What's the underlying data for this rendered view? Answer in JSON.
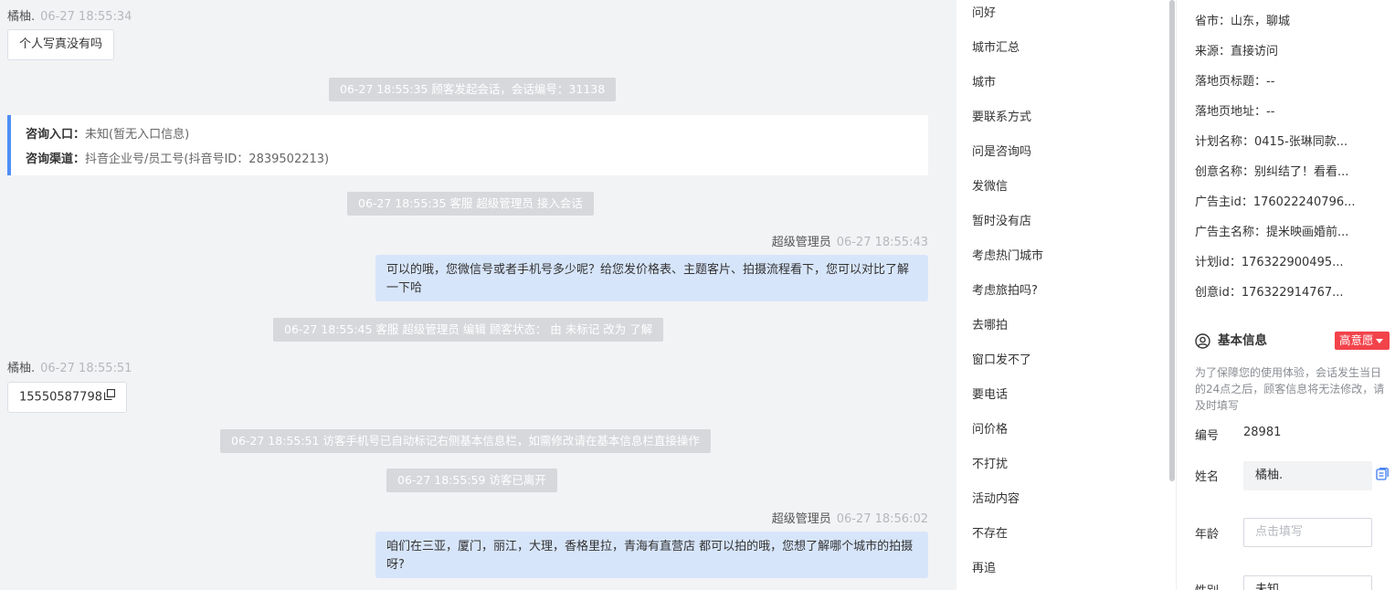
{
  "chat": {
    "msg1": {
      "name": "橘柚.",
      "time": "06-27 18:55:34",
      "text": "个人写真没有吗"
    },
    "sys1": "06-27 18:55:35 顾客发起会话，会话编号：31138",
    "card": {
      "entry_label": "咨询入口：",
      "entry_value": "未知(暂无入口信息)",
      "channel_label": "咨询渠道：",
      "channel_value": "抖音企业号/员工号(抖音号ID：2839502213)"
    },
    "sys2": "06-27 18:55:35 客服 超级管理员 接入会话",
    "msg2": {
      "name": "超级管理员",
      "time": "06-27 18:55:43",
      "text": "可以的哦，您微信号或者手机号多少呢？给您发价格表、主题客片、拍摄流程看下，您可以对比了解一下哈"
    },
    "sys3": "06-27 18:55:45 客服 超级管理员 编辑 顾客状态： 由 未标记 改为 了解",
    "msg3": {
      "name": "橘柚.",
      "time": "06-27 18:55:51",
      "text": "15550587798"
    },
    "sys4": "06-27 18:55:51 访客手机号已自动标记右侧基本信息栏，如需修改请在基本信息栏直接操作",
    "sys5": "06-27 18:55:59 访客已离开",
    "msg4": {
      "name": "超级管理员",
      "time": "06-27 18:56:02",
      "text": "咱们在三亚，厦门，丽江，大理，香格里拉，青海有直营店 都可以拍的哦，您想了解哪个城市的拍摄呀?"
    }
  },
  "quick_replies": [
    "问好",
    "城市汇总",
    "城市",
    "要联系方式",
    "问是咨询吗",
    "发微信",
    "暂时没有店",
    "考虑热门城市",
    "考虑旅拍吗?",
    "去哪拍",
    "窗口发不了",
    "要电话",
    "问价格",
    "不打扰",
    "活动内容",
    "不存在",
    "再追"
  ],
  "visitor": {
    "province": "省市：山东，聊城",
    "source": "来源：直接访问",
    "landing_title": "落地页标题：--",
    "landing_url": "落地页地址：--",
    "plan_name": "计划名称：0415-张琳同款...",
    "creative_name": "创意名称：别纠结了！看看...",
    "advertiser_id": "广告主id：176022240796...",
    "advertiser_name": "广告主名称：提米映画婚前...",
    "plan_id": "计划id：176322900495...",
    "creative_id": "创意id：176322914767..."
  },
  "basic": {
    "title": "基本信息",
    "intent": "高意愿",
    "tip": "为了保障您的使用体验，会话发生当日的24点之后，顾客信息将无法修改，请及时填写",
    "id_label": "编号",
    "id_value": "28981",
    "name_label": "姓名",
    "name_value": "橘柚.",
    "age_label": "年龄",
    "age_placeholder": "点击填写",
    "gender_label": "性别",
    "gender_value": "未知"
  }
}
